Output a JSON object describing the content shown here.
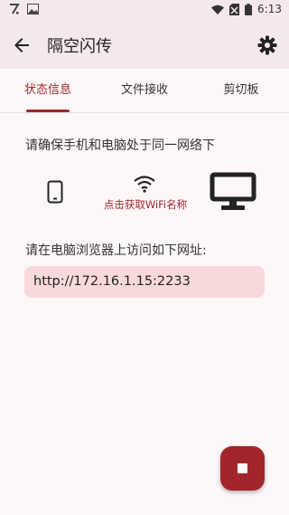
{
  "status_bar": {
    "time": "6:13"
  },
  "app_bar": {
    "title": "隔空闪传"
  },
  "tabs": [
    {
      "label": "状态信息"
    },
    {
      "label": "文件接收"
    },
    {
      "label": "剪切板"
    }
  ],
  "status": {
    "instruction": "请确保手机和电脑处于同一网络下",
    "wifi_link": "点击获取WiFi名称",
    "browser_instruction": "请在电脑浏览器上访问如下网址:",
    "url": "http://172.16.1.15:2233"
  },
  "colors": {
    "accent": "#a1262b",
    "url_bg": "#f8d9db",
    "bar_bg": "#f5e8ea"
  },
  "icons": [
    "back-arrow-icon",
    "settings-icon",
    "phone-icon",
    "wifi-icon",
    "monitor-icon",
    "stop-icon"
  ]
}
